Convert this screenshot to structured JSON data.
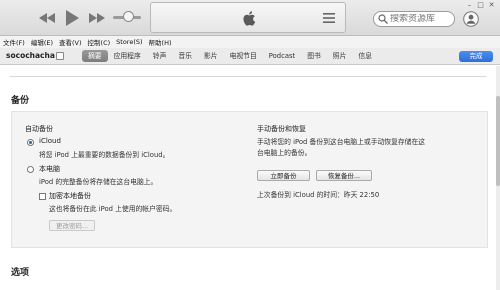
{
  "topbar": {
    "search_placeholder": "搜索资源库",
    "icons": [
      "rewind-icon",
      "play-icon",
      "fast-forward-icon",
      "apple-logo-icon",
      "list-icon",
      "search-icon",
      "account-icon"
    ]
  },
  "menu": [
    "文件(F)",
    "编辑(E)",
    "查看(V)",
    "控制(C)",
    "Store(S)",
    "帮助(H)"
  ],
  "nav": {
    "device_name": "socochacha",
    "tabs": [
      "摘要",
      "应用程序",
      "铃声",
      "音乐",
      "影片",
      "电视节目",
      "Podcast",
      "图书",
      "照片",
      "信息"
    ],
    "active_tab": "摘要",
    "done_label": "完成"
  },
  "backup": {
    "heading": "备份",
    "auto": {
      "title": "自动备份",
      "icloud_label": "iCloud",
      "icloud_desc": "将您 iPod 上最重要的数据备份到 iCloud。",
      "icloud_selected": true,
      "local_label": "本电脑",
      "local_desc": "iPod 的完整备份将存储在这台电脑上。",
      "encrypt_label": "加密本地备份",
      "encrypt_desc": "这也将备份在此 iPod 上使用的帐户密码。",
      "encrypt_checked": false,
      "change_password": "更改密码..."
    },
    "manual": {
      "title": "手动备份和恢复",
      "desc_line1": "手动将您的 iPod 备份到这台电脑上或手动恢复存储在这",
      "desc_line2": "台电脑上的备份。",
      "backup_now": "立即备份",
      "restore": "恢复备份...",
      "last_backup": "上次备份到 iCloud 的时间：昨天 22:50"
    }
  },
  "options_heading": "选项",
  "colors": {
    "accent": "#2e6fd8",
    "active_tab": "#8a8a8a"
  }
}
